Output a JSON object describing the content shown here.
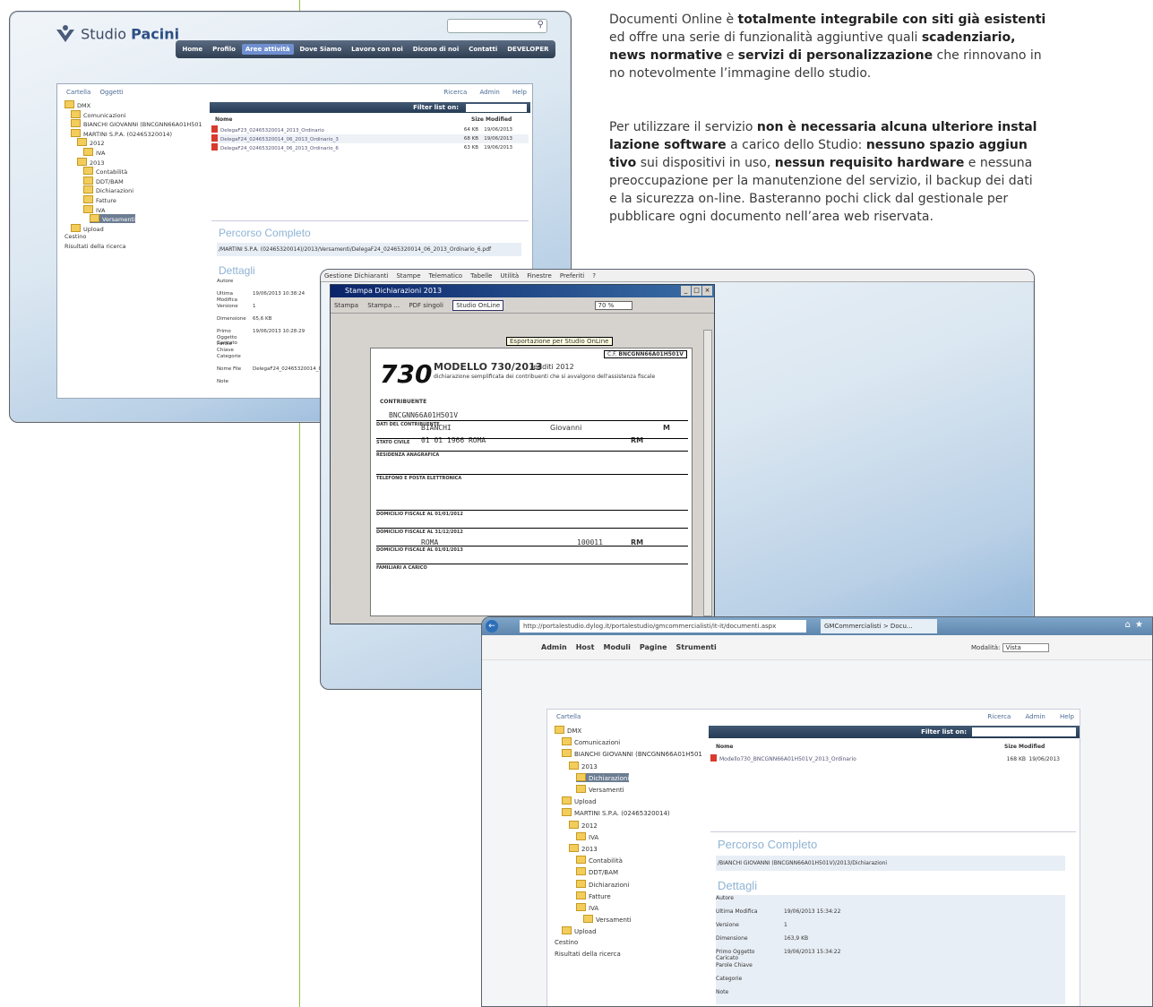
{
  "article": {
    "p1": [
      {
        "t": "Documenti Online è ",
        "b": false
      },
      {
        "t": "totalmente integrabile con siti già esistenti",
        "b": true
      },
      {
        "t": "|ed offre una serie di funzionalità aggiuntive quali ",
        "b": false
      },
      {
        "t": "scadenziario,",
        "b": true
      },
      {
        "t": "|news normative",
        "b": true
      },
      {
        "t": " e ",
        "b": false
      },
      {
        "t": "servizi di personalizzazione",
        "b": true
      },
      {
        "t": " che rinnovano in",
        "b": false
      },
      {
        "t": "|no notevolmente l’immagine dello studio.",
        "b": false
      }
    ],
    "p2": [
      {
        "t": "Per utilizzare il servizio ",
        "b": false
      },
      {
        "t": "non è necessaria alcuna ulteriore instal",
        "b": true
      },
      {
        "t": "|lazione software",
        "b": true
      },
      {
        "t": " a carico dello Studio: ",
        "b": false
      },
      {
        "t": "nessuno spazio aggiun",
        "b": true
      },
      {
        "t": "|tivo",
        "b": true
      },
      {
        "t": " sui dispositivi in uso, ",
        "b": false
      },
      {
        "t": "nessun requisito hardware",
        "b": true
      },
      {
        "t": " e nessuna",
        "b": false
      },
      {
        "t": "|preoccupazione per la manutenzione del servizio, il backup dei dati",
        "b": false
      },
      {
        "t": "|e la sicurezza on-line. Basteranno pochi click dal gestionale per",
        "b": false
      },
      {
        "t": "|pubblicare ogni documento nell’area web riservata.",
        "b": false
      }
    ]
  },
  "site": {
    "logo_text": "Studio",
    "logo_brand": "Pacini",
    "nav": [
      "Home",
      "Profilo",
      "Aree attività",
      "Dove Siamo",
      "Lavora con noi",
      "Dicono di noi",
      "Contatti",
      "DEVELOPER"
    ],
    "active_nav_index": 2,
    "breadcrumb": [
      "Cartella",
      "Oggetti"
    ],
    "links": [
      "Ricerca",
      "Admin",
      "Help"
    ],
    "filter_label": "Filter list on:",
    "tree": [
      "DMX",
      "Comunicazioni",
      "BIANCHI GIOVANNI (BNCGNN66A01H501",
      "MARTINI S.P.A. (02465320014)",
      "2012",
      "IVA",
      "2013",
      "Contabilità",
      "DDT/BAM",
      "Dichiarazioni",
      "Fatture",
      "IVA",
      "Versamenti",
      "Upload",
      "Cestino",
      "Risultati della ricerca"
    ],
    "cols": [
      "Nome",
      "Size",
      "Modified"
    ],
    "files": [
      {
        "name": "DelegaF23_02465320014_2013_Ordinario",
        "size": "64 KB",
        "date": "19/06/2013"
      },
      {
        "name": "DelegaF24_02465320014_06_2013_Ordinario_3",
        "size": "68 KB",
        "date": "19/06/2013"
      },
      {
        "name": "DelegaF24_02465320014_06_2013_Ordinario_6",
        "size": "63 KB",
        "date": "19/06/2013"
      }
    ],
    "path_title": "Percorso Completo",
    "path": "/MARTINI S.P.A. (02465320014)/2013/Versamenti/DelegaF24_02465320014_06_2013_Ordinario_6.pdf",
    "details_title": "Dettagli",
    "details": [
      [
        "Autore",
        ""
      ],
      [
        "Ultima Modifica",
        "19/06/2013 10:38:24"
      ],
      [
        "Versione",
        "1"
      ],
      [
        "Dimensione",
        "65,6 KB"
      ],
      [
        "Primo Oggetto Caricato",
        "19/06/2013 10:28:29"
      ],
      [
        "Parole Chiave",
        ""
      ],
      [
        "Categorie",
        ""
      ],
      [
        "Nome File",
        "DelegaF24_02465320014_06"
      ],
      [
        "Note",
        ""
      ]
    ]
  },
  "desktop": {
    "menu": [
      "Gestione Dichiaranti",
      "Stampe",
      "Telematico",
      "Tabelle",
      "Utilità",
      "Finestre",
      "Preferiti",
      "?"
    ],
    "window_title": "Stampa Dichiarazioni 2013",
    "toolbar": [
      "Stampa",
      "Stampa ...",
      "PDF singoli",
      "Studio OnLine",
      "70 %"
    ],
    "tooltip": "Esportazione per Studio OnLine",
    "form": {
      "code_label": "C.F.",
      "code": "BNCGNN66A01H501V",
      "logo_num": "730",
      "title": "MODELLO 730/2013",
      "redditi": "redditi 2012",
      "subtitle": "dichiarazione semplificata dei contribuenti che si avvalgono dell'assistenza fiscale",
      "section": "CONTRIBUENTE",
      "cf": "BNCGNN66A01H501V",
      "cognome": "BIANCHI",
      "nome": "Giovanni",
      "sesso": "M",
      "nascita": "01  01  1966  ROMA",
      "prov": "RM",
      "rows": [
        "DATI DEL CONTRIBUENTE",
        "STATO CIVILE",
        "RESIDENZA ANAGRAFICA",
        "TELEFONO E POSTA ELETTRONICA",
        "DOMICILIO FISCALE AL 01/01/2012",
        "DOMICILIO FISCALE AL 31/12/2012",
        "DOMICILIO FISCALE AL 01/01/2013",
        "FAMILIARI A CARICO"
      ],
      "dom_city": "ROMA",
      "cap": "100011",
      "dom_prov": "RM"
    }
  },
  "browser": {
    "url": "http://portalestudio.dylog.it/portalestudio/gmcommercialisti/it-it/documenti.aspx",
    "tab": "GMCommercialisti > Docu...",
    "admin_menu": [
      "Admin",
      "Host",
      "Moduli",
      "Pagine",
      "Strumenti"
    ],
    "mode_label": "Modalità:",
    "mode_value": "Vista",
    "breadcrumb": "Cartella",
    "links": [
      "Ricerca",
      "Admin",
      "Help"
    ],
    "filter_label": "Filter list on:",
    "tree": [
      "DMX",
      "Comunicazioni",
      "BIANCHI GIOVANNI (BNCGNN66A01H501",
      "2013",
      "Dichiarazioni",
      "Versamenti",
      "Upload",
      "MARTINI S.P.A. (02465320014)",
      "2012",
      "IVA",
      "2013",
      "Contabilità",
      "DDT/BAM",
      "Dichiarazioni",
      "Fatture",
      "IVA",
      "Versamenti",
      "Upload",
      "Cestino",
      "Risultati della ricerca"
    ],
    "cols": [
      "Nome",
      "Size",
      "Modified"
    ],
    "files": [
      {
        "name": "Modello730_BNCGNN66A01H501V_2013_Ordinario",
        "size": "168 KB",
        "date": "19/06/2013"
      }
    ],
    "path_title": "Percorso Completo",
    "path": "/BIANCHI GIOVANNI (BNCGNN66A01H501V)/2013/Dichiarazioni",
    "details_title": "Dettagli",
    "details": [
      [
        "Autore",
        ""
      ],
      [
        "Ultima Modifica",
        "19/06/2013 15:34:22"
      ],
      [
        "Versione",
        "1"
      ],
      [
        "Dimensione",
        "163,9 KB"
      ],
      [
        "Primo Oggetto Caricato",
        "19/06/2013 15:34:22"
      ],
      [
        "Parole Chiave",
        ""
      ],
      [
        "Categorie",
        ""
      ],
      [
        "Note",
        ""
      ]
    ]
  }
}
